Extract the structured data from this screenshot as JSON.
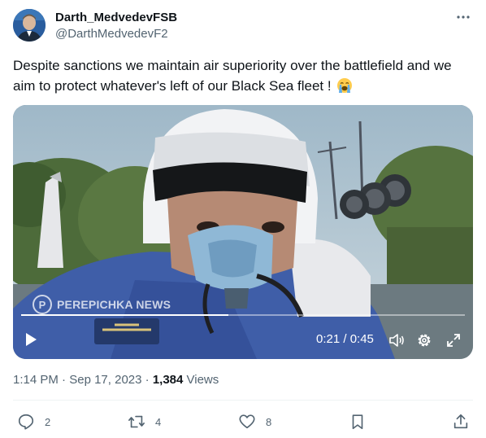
{
  "author": {
    "display_name": "Darth_MedvedevFSB",
    "handle": "@DarthMedvedevF2"
  },
  "tweet": {
    "text": "Despite sanctions we maintain air superiority over the battlefield and we aim to protect whatever's left of our Black Sea fleet  ! ",
    "emoji": "loudly-crying-face"
  },
  "video": {
    "watermark": "PEREPICHKA NEWS",
    "watermark_logo": "P",
    "time_display": "0:21 / 0:45",
    "progress": 0.467
  },
  "meta": {
    "time": "1:14 PM",
    "separator": " · ",
    "date": "Sep 17, 2023",
    "views_count": "1,384",
    "views_label": " Views"
  },
  "actions": {
    "replies": "2",
    "reposts": "4",
    "likes": "8"
  },
  "icons": {
    "more": "more-icon",
    "reply": "reply-icon",
    "repost": "repost-icon",
    "like": "heart-icon",
    "bookmark": "bookmark-icon",
    "share": "share-icon"
  },
  "colors": {
    "text": "#0f1419",
    "secondary": "#536471",
    "divider": "#eff3f4"
  }
}
